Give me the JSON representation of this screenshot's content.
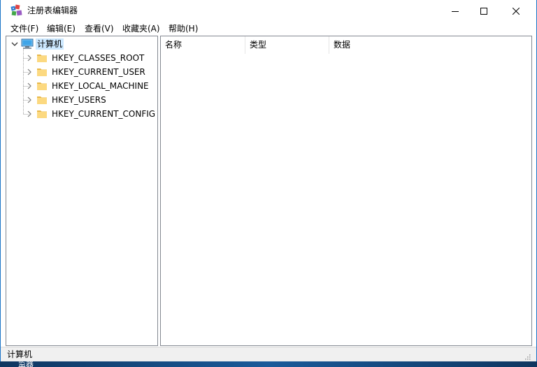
{
  "window": {
    "title": "注册表编辑器",
    "accent": "#1a73c7"
  },
  "menu": [
    {
      "label": "文件(F)"
    },
    {
      "label": "编辑(E)"
    },
    {
      "label": "查看(V)"
    },
    {
      "label": "收藏夹(A)"
    },
    {
      "label": "帮助(H)"
    }
  ],
  "tree": {
    "root": {
      "label": "计算机",
      "icon": "computer-icon",
      "expanded": true,
      "selected_color": "#cce8ff"
    },
    "children": [
      {
        "label": "HKEY_CLASSES_ROOT",
        "icon": "folder-icon"
      },
      {
        "label": "HKEY_CURRENT_USER",
        "icon": "folder-icon"
      },
      {
        "label": "HKEY_LOCAL_MACHINE",
        "icon": "folder-icon"
      },
      {
        "label": "HKEY_USERS",
        "icon": "folder-icon"
      },
      {
        "label": "HKEY_CURRENT_CONFIG",
        "icon": "folder-icon"
      }
    ]
  },
  "list": {
    "columns": [
      {
        "label": "名称"
      },
      {
        "label": "类型"
      },
      {
        "label": "数据"
      }
    ]
  },
  "status": {
    "path": "计算机"
  },
  "desktop": {
    "icon_label": "监器"
  }
}
